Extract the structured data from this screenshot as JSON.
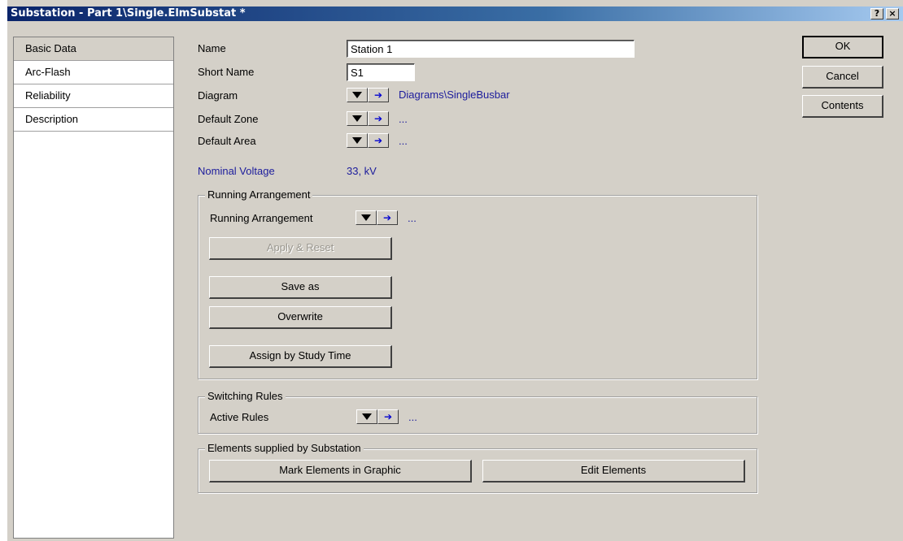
{
  "window": {
    "title": "Substation - Part 1\\Single.ElmSubstat *",
    "help_btn": "?",
    "close_btn": "×"
  },
  "sidebar": {
    "items": [
      {
        "label": "Basic Data",
        "active": true
      },
      {
        "label": "Arc-Flash"
      },
      {
        "label": "Reliability"
      },
      {
        "label": "Description"
      }
    ]
  },
  "fields": {
    "name_label": "Name",
    "name_value": "Station 1",
    "short_name_label": "Short Name",
    "short_name_value": "S1",
    "diagram_label": "Diagram",
    "diagram_value": "Diagrams\\SingleBusbar",
    "zone_label": "Default Zone",
    "zone_value": "...",
    "area_label": "Default Area",
    "area_value": "...",
    "voltage_label": "Nominal Voltage",
    "voltage_value": "33, kV"
  },
  "running": {
    "group_label": "Running Arrangement",
    "field_label": "Running Arrangement",
    "field_value": "...",
    "apply_reset": "Apply & Reset",
    "save_as": "Save as",
    "overwrite": "Overwrite",
    "assign": "Assign by Study Time"
  },
  "switching": {
    "group_label": "Switching Rules",
    "field_label": "Active Rules",
    "field_value": "..."
  },
  "elements": {
    "group_label": "Elements supplied by Substation",
    "mark": "Mark Elements in Graphic",
    "edit": "Edit Elements"
  },
  "actions": {
    "ok": "OK",
    "cancel": "Cancel",
    "contents": "Contents"
  },
  "colors": {
    "titlebar": "#0a246a",
    "face": "#d4d0c8",
    "link": "#1c1c9c",
    "arrow": "#0000d0"
  },
  "icons": [
    "dropdown-arrow-icon",
    "jump-arrow-icon"
  ]
}
